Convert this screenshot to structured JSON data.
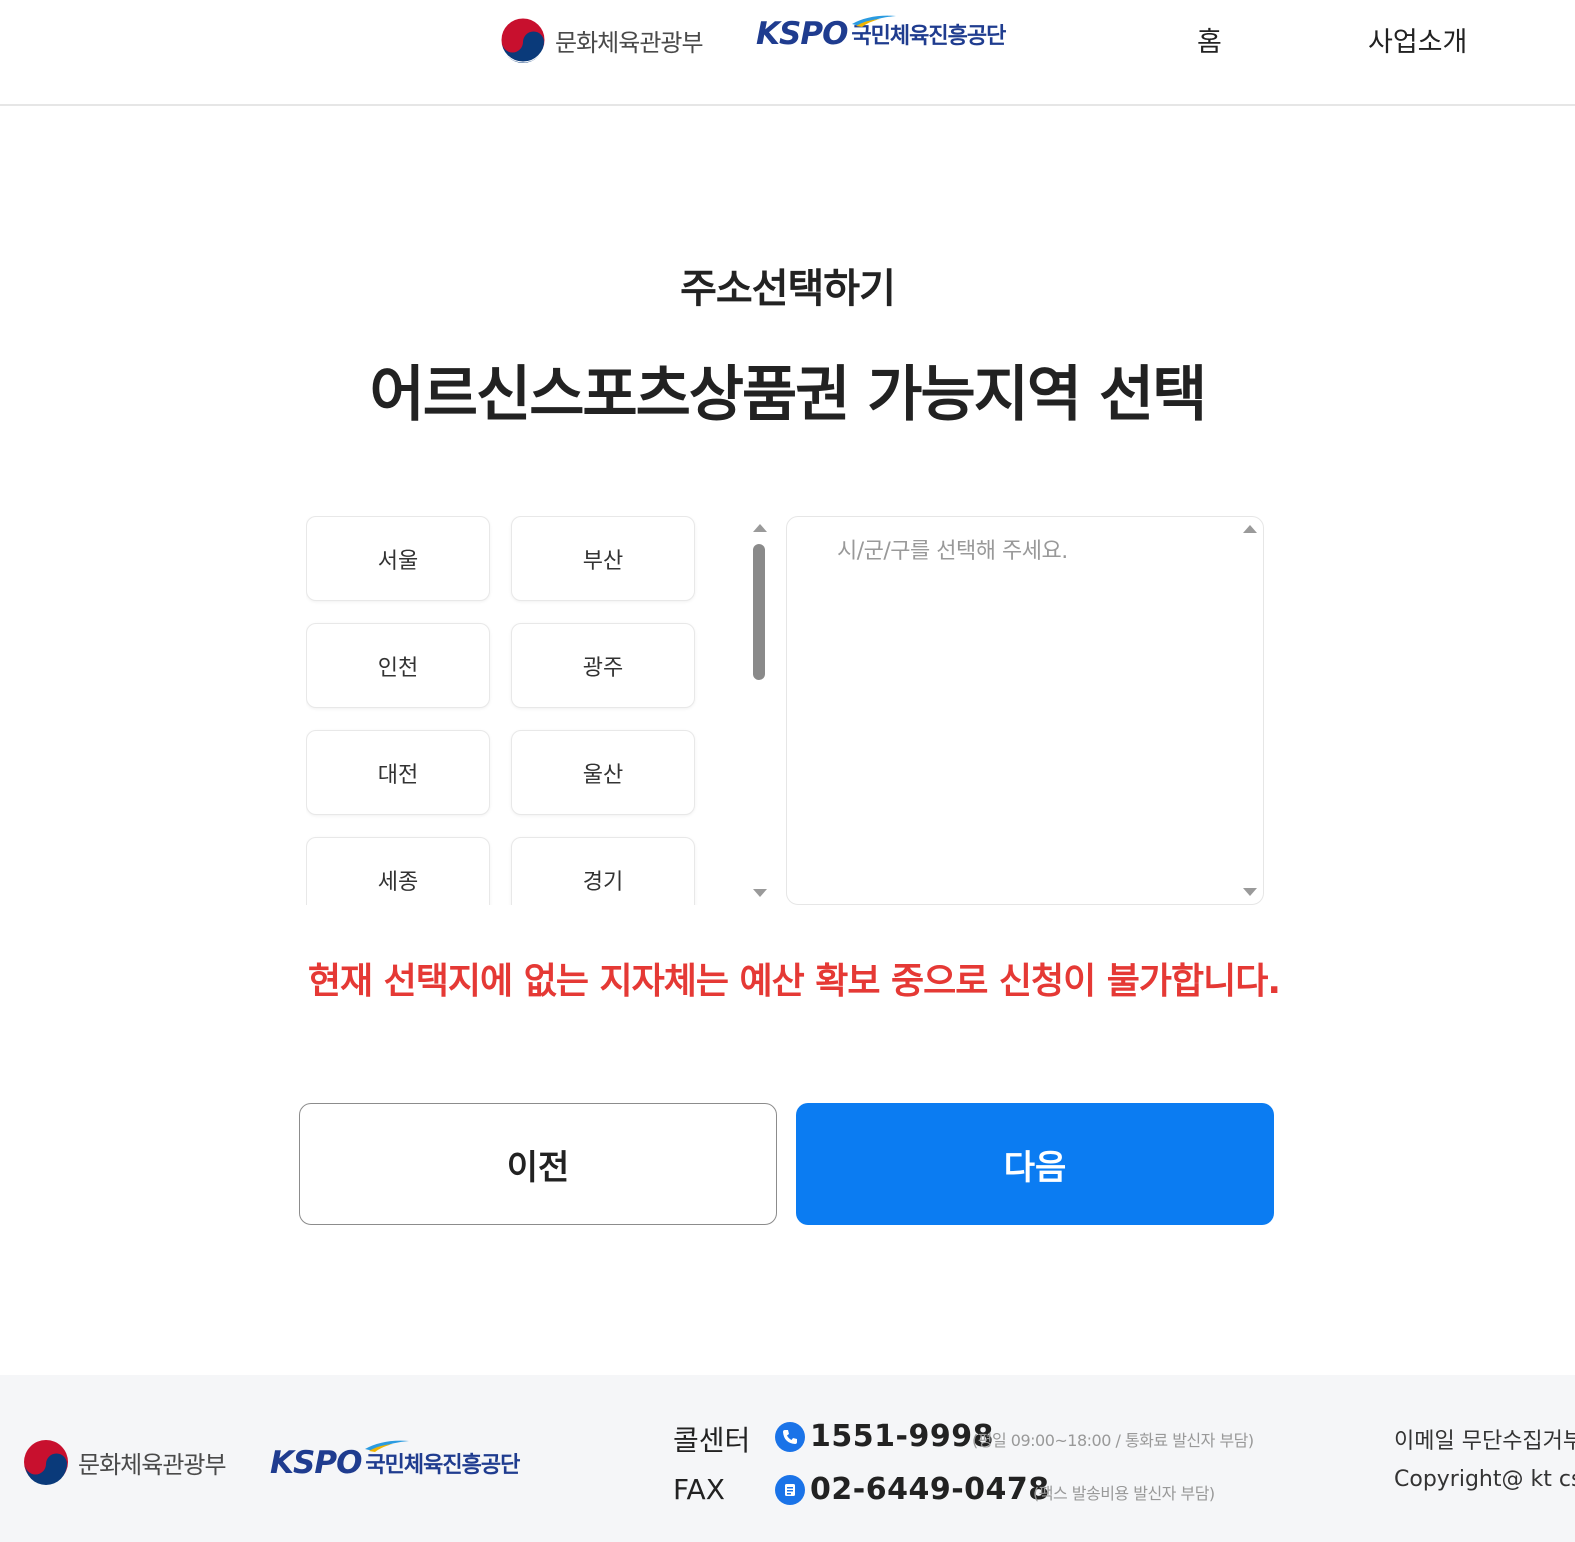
{
  "header": {
    "mcst_name": "문화체육관광부",
    "kspo_mark": "KSPO",
    "kspo_name": "국민체육진흥공단",
    "nav": [
      {
        "label": "홈"
      },
      {
        "label": "사업소개"
      }
    ]
  },
  "titles": {
    "subtitle": "주소선택하기",
    "main": "어르신스포츠상품권 가능지역 선택"
  },
  "regions": [
    {
      "label": "서울"
    },
    {
      "label": "부산"
    },
    {
      "label": "인천"
    },
    {
      "label": "광주"
    },
    {
      "label": "대전"
    },
    {
      "label": "울산"
    },
    {
      "label": "세종"
    },
    {
      "label": "경기"
    }
  ],
  "district": {
    "placeholder": "시/군/구를 선택해 주세요."
  },
  "notice": "현재 선택지에 없는 지자체는 예산 확보 중으로 신청이 불가합니다.",
  "actions": {
    "prev_label": "이전",
    "next_label": "다음"
  },
  "footer": {
    "mcst_name": "문화체육관광부",
    "kspo_mark": "KSPO",
    "kspo_name": "국민체육진흥공단",
    "call_center_label": "콜센터",
    "call_center_number": "1551-9998",
    "call_center_note": "(평일 09:00~18:00 / 통화료 발신자 부담)",
    "fax_label": "FAX",
    "fax_number": "02-6449-0478",
    "fax_note": "(팩스 발송비용 발신자 부담)",
    "email_policy": "이메일 무단수집거부",
    "copyright": "Copyright@ kt cs"
  },
  "colors": {
    "primary": "#0b7cf2",
    "notice": "#e53935",
    "brand_navy": "#1f3c8f"
  }
}
